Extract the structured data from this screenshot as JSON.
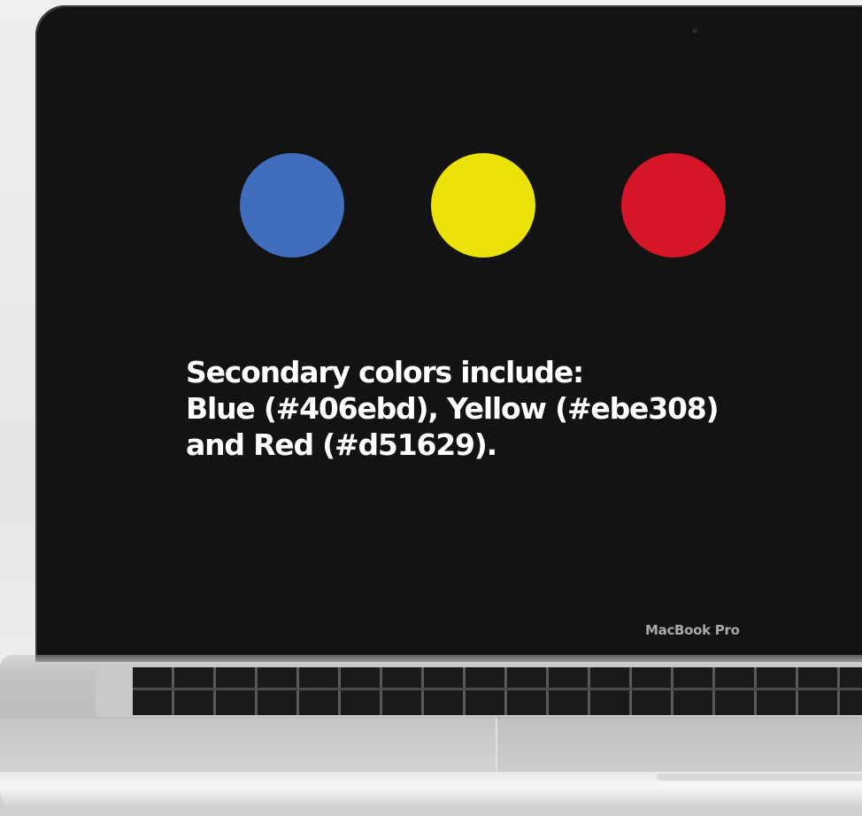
{
  "caption": {
    "line1": "Secondary colors include:",
    "line2": "Blue (#406ebd), Yellow (#ebe308)",
    "line3": "and Red (#d51629)."
  },
  "swatches": [
    {
      "name": "Blue",
      "color": "#406ebd"
    },
    {
      "name": "Yellow",
      "color": "#ebe308"
    },
    {
      "name": "Red",
      "color": "#d51629"
    }
  ],
  "device": {
    "brand_label": "MacBook Pro"
  }
}
